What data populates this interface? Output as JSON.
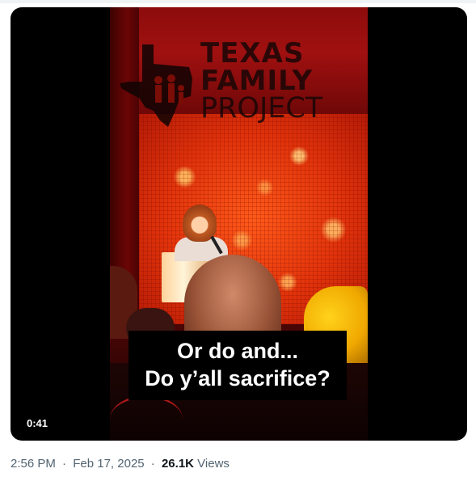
{
  "video": {
    "logo": {
      "line1": "TEXAS",
      "line2": "FAMILY",
      "line3": "PROJECT"
    },
    "caption": {
      "line1": "Or do and...",
      "line2": "Do y’all sacrifice?"
    },
    "duration": "0:41"
  },
  "meta": {
    "time": "2:56 PM",
    "separator": "·",
    "date": "Feb 17, 2025",
    "views_count": "26.1K",
    "views_label": "Views"
  },
  "colors": {
    "background": "#ffffff",
    "video_bg": "#000000",
    "meta_text": "#536471",
    "views_text": "#0f1419",
    "stage_orange": "#e2330b"
  }
}
